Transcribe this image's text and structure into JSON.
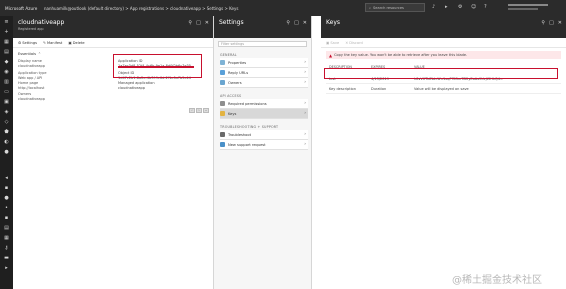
{
  "topbar": {
    "brand": "Microsoft Azure",
    "breadcrumb": "nanhuamilk@outlook (default directory) > App registrations > cloudnativeapp > Settings > Keys",
    "search_placeholder": "Search resources"
  },
  "blade_app": {
    "title": "cloudnativeapp",
    "subtitle": "Registered app",
    "toolbar": [
      "Settings",
      "Manifest",
      "Delete"
    ],
    "essentials": "Essentials",
    "rows": [
      {
        "label": "Display name",
        "value": "cloudnativeapp"
      },
      {
        "label": "Application type",
        "value": "Web app / API"
      },
      {
        "label": "Home page",
        "value": "http://localhost"
      },
      {
        "label": "Managed application",
        "value": "cloudnativeapp"
      },
      {
        "label": "Object ID",
        "value": "1d47c2b1-8a2e-4b3f-9c6d-2f1e0a7b5c44"
      },
      {
        "label": "Owners",
        "value": "cloudnativeapp"
      }
    ],
    "app_id_label": "Application ID",
    "app_id_value": "1a7ec3d8-52f4-4c6b-9e1a-8d0f2b6c7e35"
  },
  "blade_settings": {
    "title": "Settings",
    "filter_placeholder": "Filter settings",
    "sections": [
      {
        "title": "General",
        "items": [
          "Properties",
          "Reply URLs",
          "Owners"
        ]
      },
      {
        "title": "API access",
        "items": [
          "Required permissions",
          "Keys"
        ]
      },
      {
        "title": "Troubleshooting + support",
        "items": [
          "Troubleshoot",
          "New support request"
        ]
      }
    ],
    "selected": "Keys"
  },
  "blade_keys": {
    "title": "Keys",
    "toolbar": [
      "Save",
      "Discard"
    ],
    "warning": "Copy the key value. You won't be able to retrieve after you leave this blade.",
    "columns": [
      "Description",
      "Expires",
      "Value"
    ],
    "keys": [
      {
        "description": "test",
        "expires": "4/13/2019",
        "value": "h8vV0TkZbLrWn1xqPf3Gm7D2yEoAs9UcJt5HkQ4="
      },
      {
        "description": "Key description",
        "expires": "Duration",
        "value": "Value will be displayed on save"
      }
    ]
  },
  "watermark": "@稀土掘金技术社区"
}
